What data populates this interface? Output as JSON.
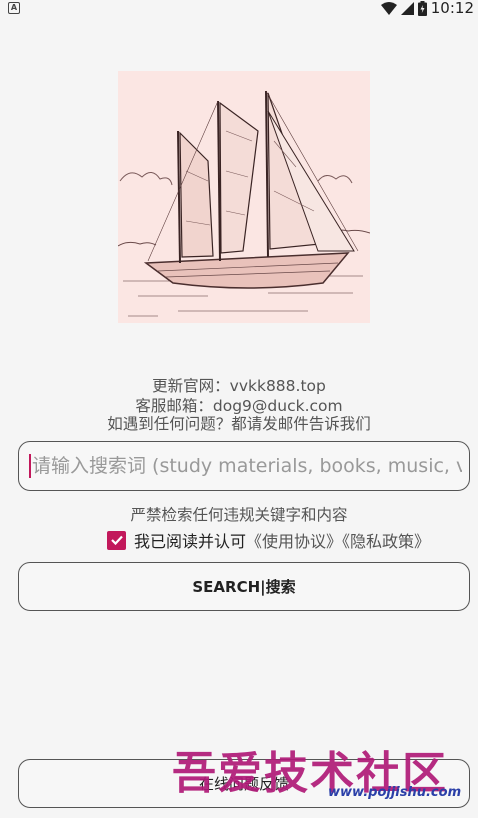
{
  "status_bar": {
    "left_icon": "a-notification-icon",
    "time": "10:12",
    "icons": [
      "wifi-icon",
      "signal-icon",
      "battery-icon"
    ]
  },
  "hero": {
    "icon": "sailing-ship-illustration",
    "background": "#fbe6e3"
  },
  "info": {
    "line1": "更新官网：vvkk888.top",
    "line2": "客服邮箱：dog9@duck.com",
    "line3": "如遇到任何问题？都请发邮件告诉我们"
  },
  "search": {
    "placeholder": "请输入搜索词 (study materials, books, music, videos)"
  },
  "warning": "严禁检索任何违规关键字和内容",
  "agreement": {
    "checked": true,
    "text": "我已阅读并认可",
    "links": "《使用协议》《隐私政策》"
  },
  "buttons": {
    "search": "SEARCH|搜索",
    "feedback": "在线问题反馈"
  },
  "watermark": {
    "text": "吾爱技术社区",
    "url": "www.pojjishu.com"
  },
  "colors": {
    "accent": "#c2185b",
    "background": "#f5f5f5"
  }
}
